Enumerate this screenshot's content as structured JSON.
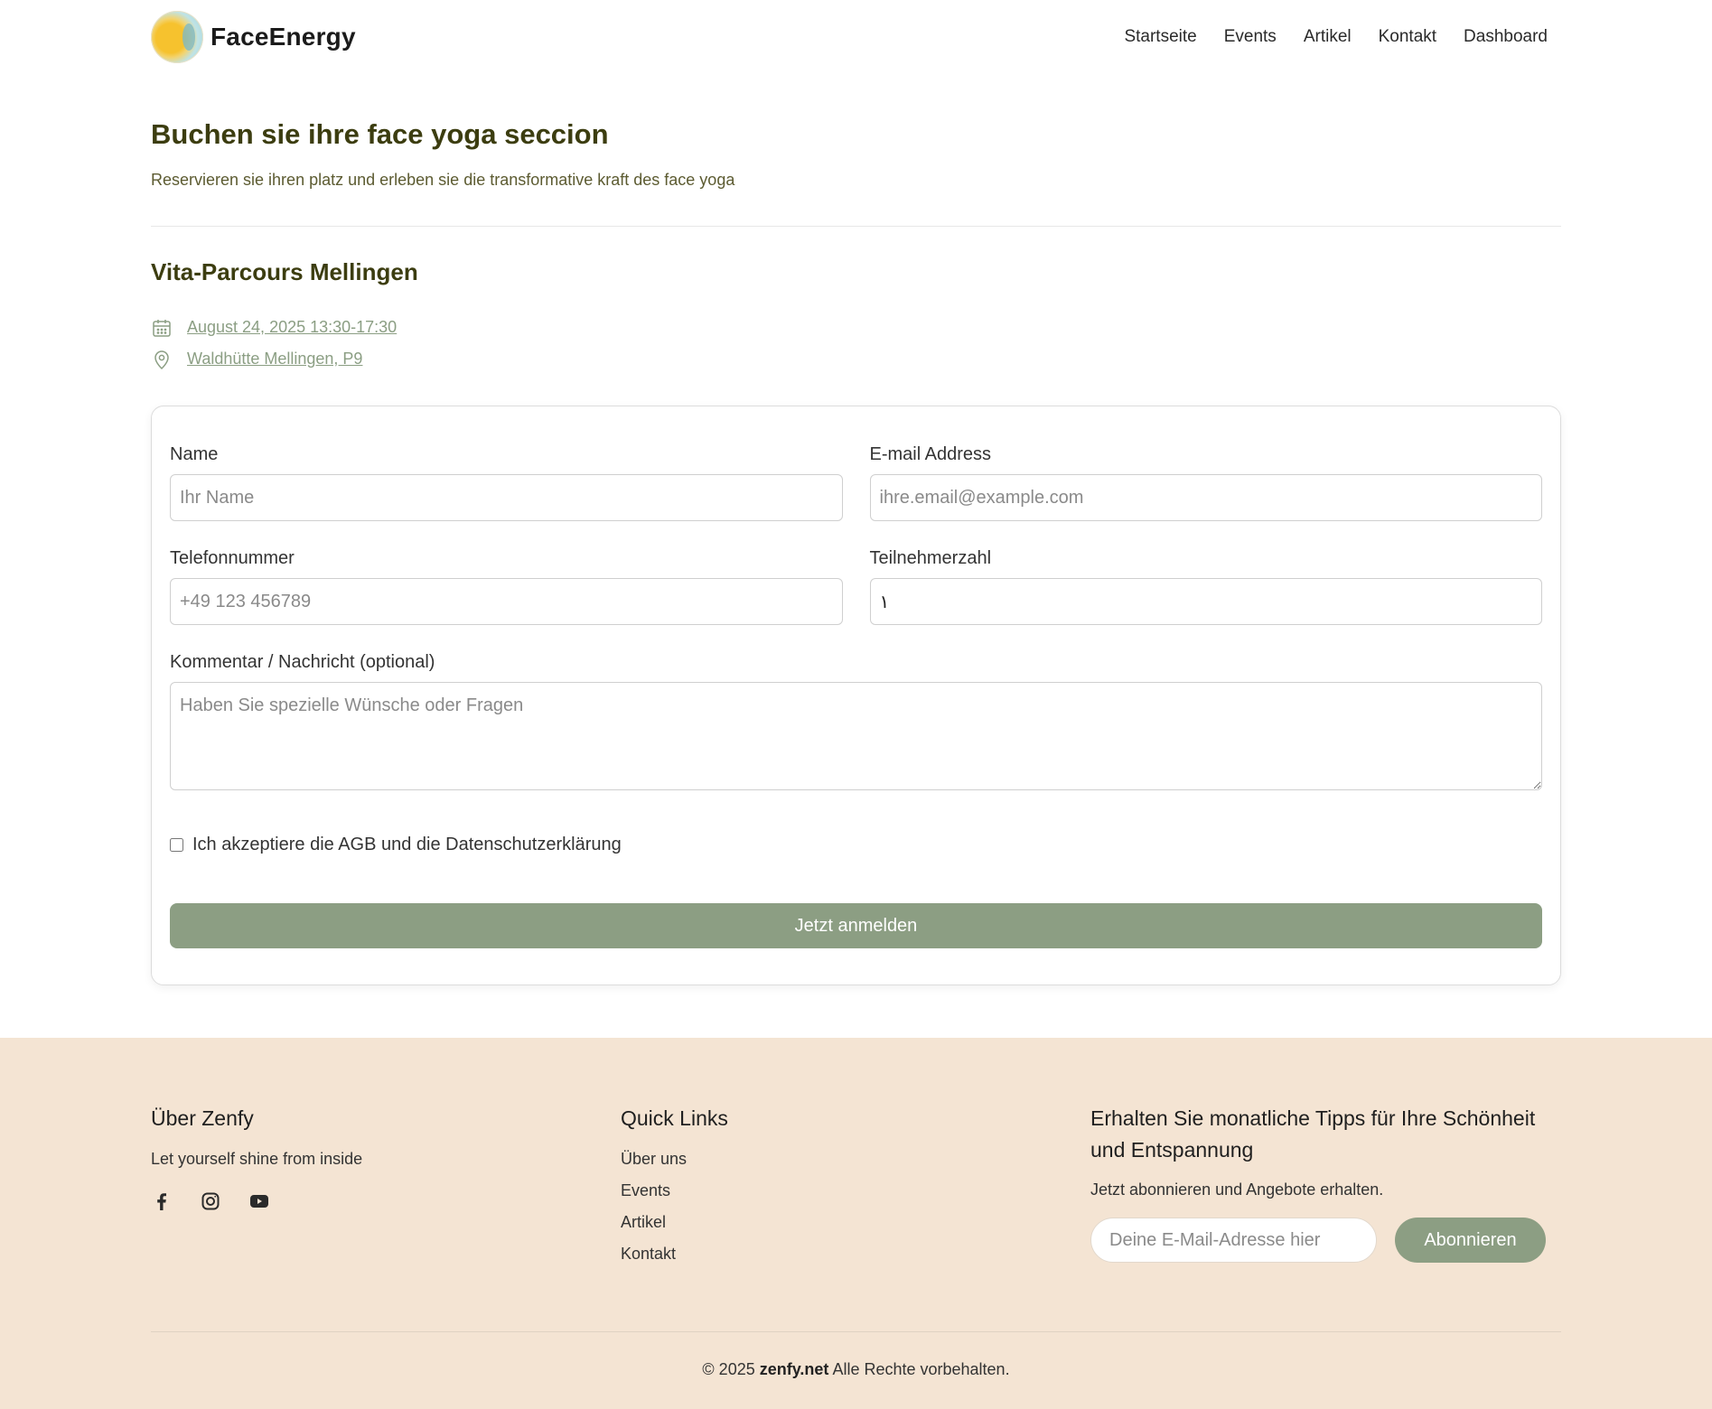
{
  "header": {
    "brand": "FaceEnergy",
    "nav": [
      "Startseite",
      "Events",
      "Artikel",
      "Kontakt",
      "Dashboard"
    ]
  },
  "hero": {
    "title": "Buchen sie ihre face yoga seccion",
    "subtitle": "Reservieren sie ihren platz und erleben sie die transformative kraft des face yoga"
  },
  "event": {
    "title": "Vita-Parcours Mellingen",
    "datetime": "August 24, 2025 13:30-17:30",
    "location": "Waldhütte Mellingen, P9"
  },
  "form": {
    "name_label": "Name",
    "name_placeholder": "Ihr Name",
    "email_label": "E-mail Address",
    "email_placeholder": "ihre.email@example.com",
    "phone_label": "Telefonnummer",
    "phone_placeholder": "+49 123 456789",
    "participants_label": "Teilnehmerzahl",
    "participants_value": "١",
    "comment_label": "Kommentar / Nachricht (optional)",
    "comment_placeholder": "Haben Sie spezielle Wünsche oder Fragen",
    "agree_label": "Ich akzeptiere die AGB und die Datenschutzerklärung",
    "submit_label": "Jetzt anmelden"
  },
  "footer": {
    "about_title": "Über Zenfy",
    "about_text": "Let yourself shine from inside",
    "links_title": "Quick Links",
    "links": [
      "Über uns",
      "Events",
      "Artikel",
      "Kontakt"
    ],
    "news_title": "Erhalten Sie monatliche Tipps für Ihre Schönheit und Entspannung",
    "news_text": "Jetzt abonnieren und Angebote erhalten.",
    "news_placeholder": "Deine E-Mail-Adresse hier",
    "news_button": "Abonnieren",
    "copyright_prefix": "© 2025",
    "copyright_brand": "zenfy.net",
    "copyright_suffix": "Alle Rechte vorbehalten."
  },
  "colors": {
    "accent": "#8c9e83",
    "title": "#3c3d10",
    "footer_bg": "#f4e4d3"
  }
}
